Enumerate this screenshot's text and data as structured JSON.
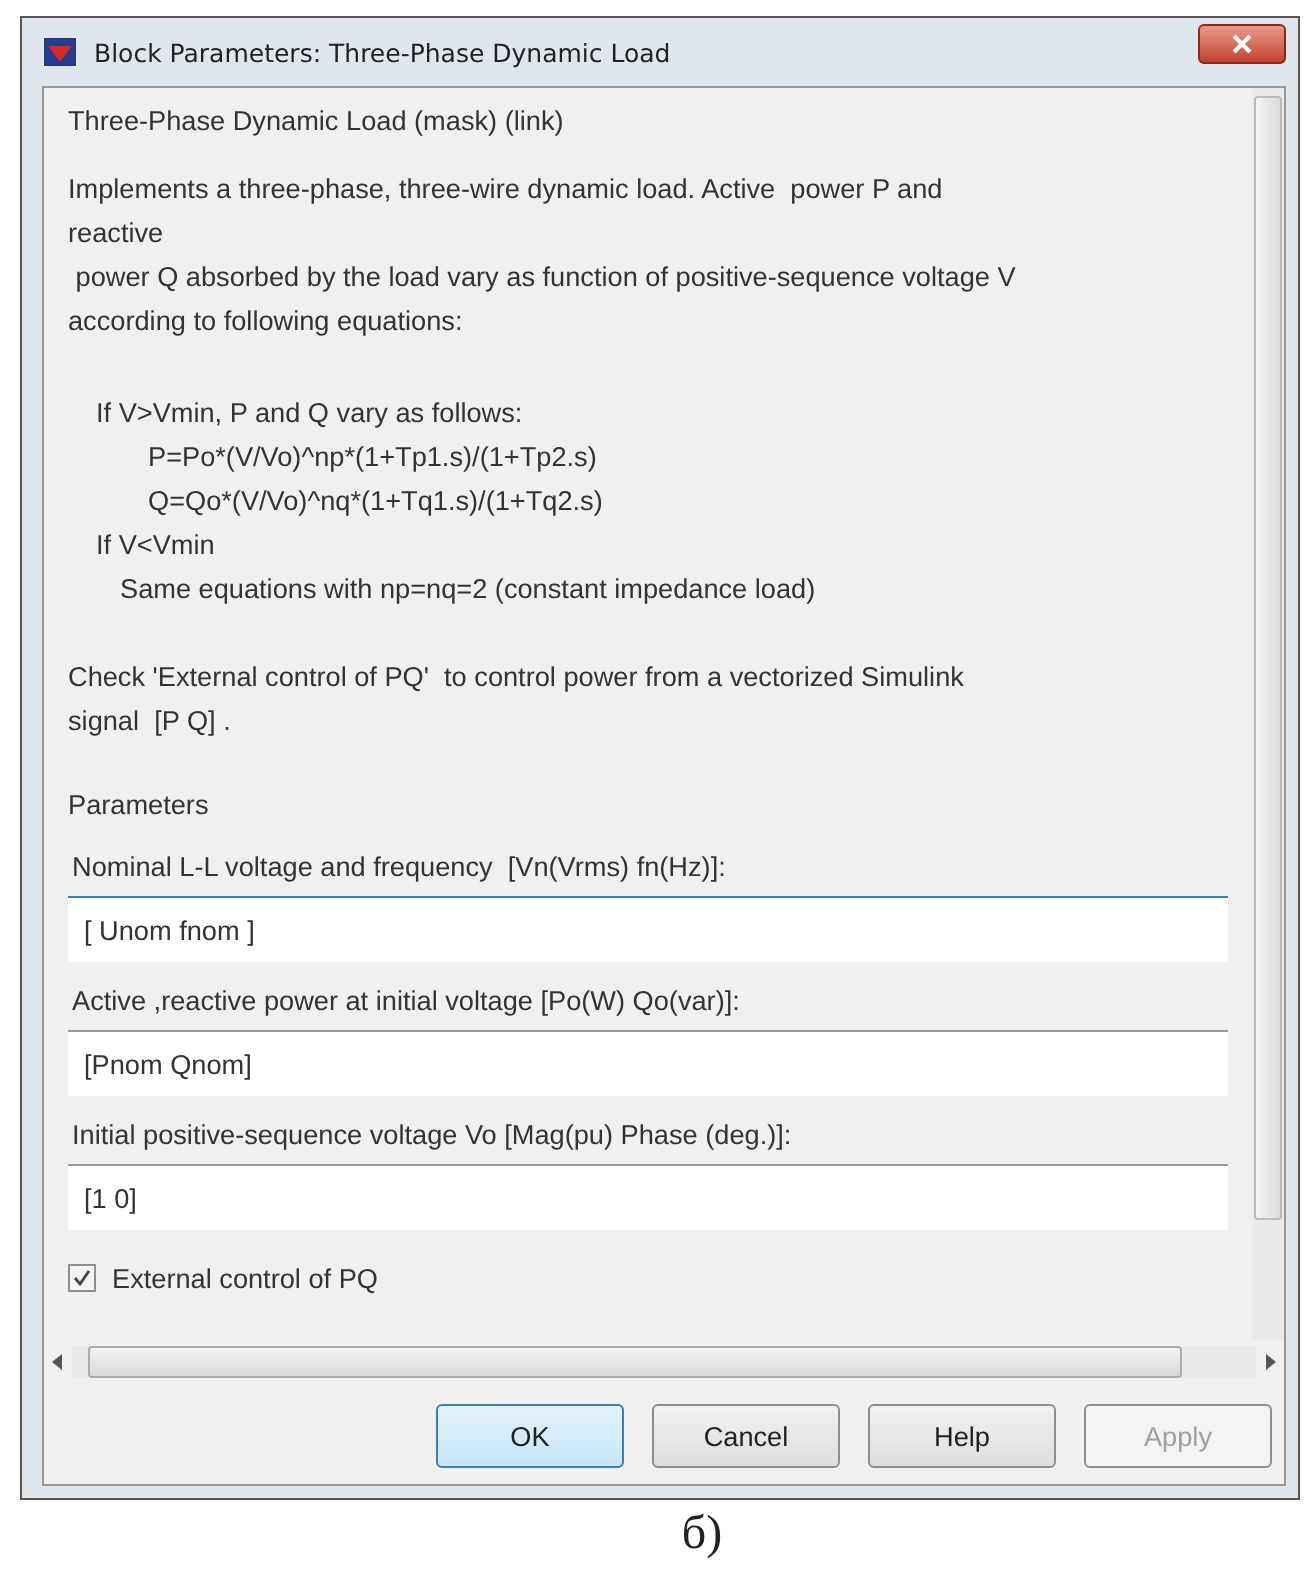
{
  "window": {
    "title": "Block Parameters: Three-Phase Dynamic Load"
  },
  "block_title": "Three-Phase Dynamic Load (mask) (link)",
  "description": [
    "Implements a three-phase, three-wire dynamic load. Active  power P and",
    "reactive",
    " power Q absorbed by the load vary as function of positive-sequence voltage V",
    "according to following equations:"
  ],
  "equations": [
    {
      "kind": "condition",
      "text": "If V>Vmin, P and Q vary as follows:"
    },
    {
      "kind": "formula",
      "text": "P=Po*(V/Vo)^np*(1+Tp1.s)/(1+Tp2.s)"
    },
    {
      "kind": "formula",
      "text": "Q=Qo*(V/Vo)^nq*(1+Tq1.s)/(1+Tq2.s)"
    },
    {
      "kind": "condition",
      "text": "If V<Vmin"
    },
    {
      "kind": "note",
      "text": "Same equations with np=nq=2 (constant impedance load)"
    }
  ],
  "note": [
    "Check 'External control of PQ'  to control power from a vectorized Simulink",
    "signal  [P Q] ."
  ],
  "parameters_heading": "Parameters",
  "parameters": [
    {
      "label": "Nominal L-L voltage and frequency  [Vn(Vrms) fn(Hz)]:",
      "value": "[ Unom fnom ]",
      "focused": true
    },
    {
      "label": "Active ,reactive power at initial voltage [Po(W) Qo(var)]:",
      "value": "[Pnom Qnom]",
      "focused": false
    },
    {
      "label": "Initial positive-sequence voltage Vo [Mag(pu) Phase (deg.)]:",
      "value": "[1 0]",
      "focused": false
    }
  ],
  "checkbox": {
    "label": "External control of PQ",
    "checked": true
  },
  "buttons": [
    {
      "label": "OK",
      "default": true,
      "disabled": false
    },
    {
      "label": "Cancel",
      "default": false,
      "disabled": false
    },
    {
      "label": "Help",
      "default": false,
      "disabled": false
    },
    {
      "label": "Apply",
      "default": false,
      "disabled": true
    }
  ],
  "caption": "б)"
}
